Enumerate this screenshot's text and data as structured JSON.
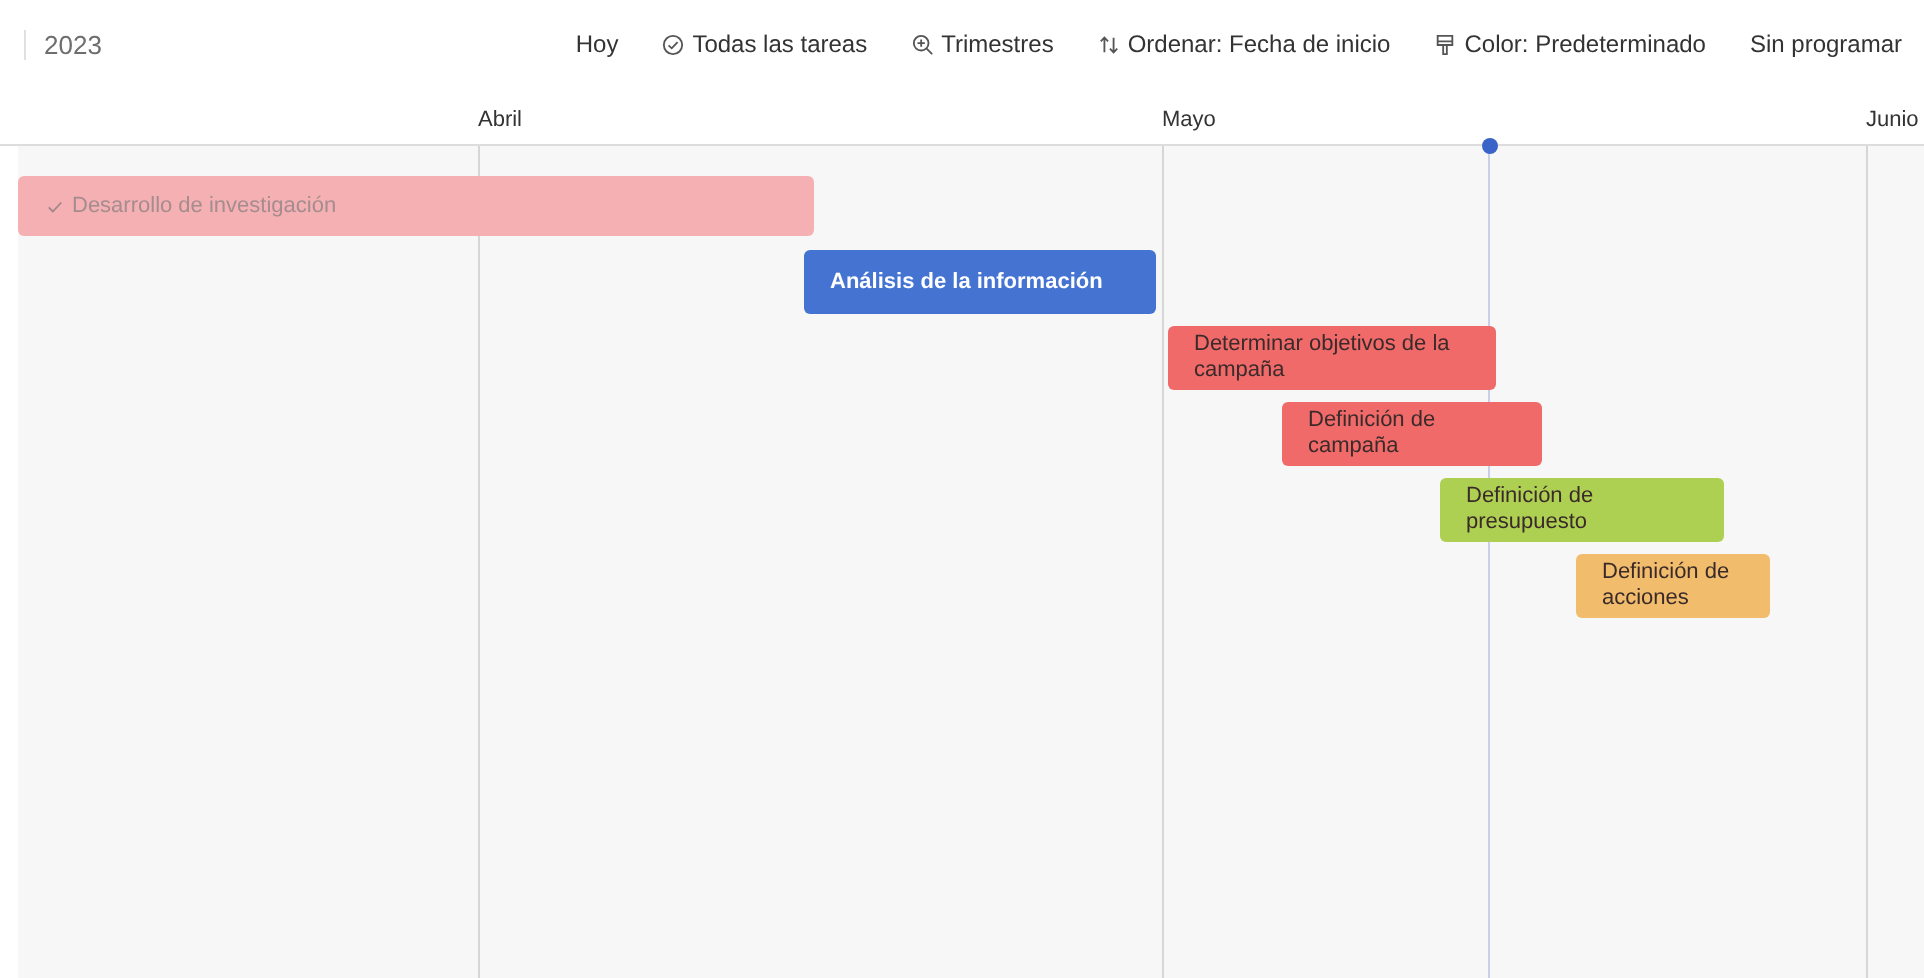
{
  "year": "2023",
  "toolbar": [
    {
      "label": "Hoy",
      "kind": "plain"
    },
    {
      "label": "Todas las tareas",
      "kind": "filter"
    },
    {
      "label": "Trimestres",
      "kind": "zoom"
    },
    {
      "label": "Ordenar: Fecha de inicio",
      "kind": "sort"
    },
    {
      "label": "Color: Predeterminado",
      "kind": "color"
    },
    {
      "label": "Sin programar",
      "kind": "plain"
    }
  ],
  "months": [
    "Abril",
    "Mayo",
    "Junio"
  ],
  "tasks": [
    {
      "name": "Desarrollo de investigación",
      "completed": true,
      "color": "#f4b0b2"
    },
    {
      "name": "Análisis de la información",
      "completed": false,
      "color": "#4573d2"
    },
    {
      "name": "Determinar objetivos de la campaña",
      "completed": false,
      "color": "#f06a6a"
    },
    {
      "name": "Definición de campaña",
      "completed": false,
      "color": "#f06a6a"
    },
    {
      "name": "Definición de presupuesto",
      "completed": false,
      "color": "#aed052"
    },
    {
      "name": "Definición de acciones",
      "completed": false,
      "color": "#f1bd6c"
    }
  ]
}
